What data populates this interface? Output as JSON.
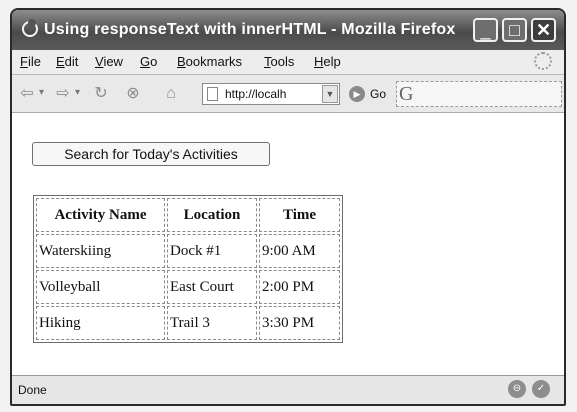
{
  "window": {
    "title": "Using responseText with innerHTML - Mozilla Firefox"
  },
  "titlebar": {
    "minimize_glyph": "_",
    "maximize_glyph": "□",
    "close_glyph": "✕"
  },
  "menu": {
    "items": [
      {
        "label": "File",
        "mnemonic": "F",
        "rest": "ile"
      },
      {
        "label": "Edit",
        "mnemonic": "E",
        "rest": "dit"
      },
      {
        "label": "View",
        "mnemonic": "V",
        "rest": "iew"
      },
      {
        "label": "Go",
        "mnemonic": "G",
        "rest": "o"
      },
      {
        "label": "Bookmarks",
        "mnemonic": "B",
        "rest": "ookmarks"
      },
      {
        "label": "Tools",
        "mnemonic": "T",
        "rest": "ools"
      },
      {
        "label": "Help",
        "mnemonic": "H",
        "rest": "elp"
      }
    ]
  },
  "nav": {
    "back_glyph": "⇦",
    "forward_glyph": "⇨",
    "dropdown_glyph": "▾",
    "reload_glyph": "↻",
    "stop_glyph": "⊗",
    "home_glyph": "⌂",
    "url": "http://localh",
    "url_dropdown_glyph": "▼",
    "go_glyph": "▶",
    "go_label": "Go",
    "search_engine_glyph": "G"
  },
  "page": {
    "search_button_label": "Search for Today's Activities",
    "table": {
      "headers": [
        "Activity Name",
        "Location",
        "Time"
      ],
      "rows": [
        [
          "Waterskiing",
          "Dock #1",
          "9:00 AM"
        ],
        [
          "Volleyball",
          "East Court",
          "2:00 PM"
        ],
        [
          "Hiking",
          "Trail 3",
          "3:30 PM"
        ]
      ]
    }
  },
  "status": {
    "text": "Done",
    "icon1_glyph": "⊖",
    "icon2_glyph": "✓"
  }
}
